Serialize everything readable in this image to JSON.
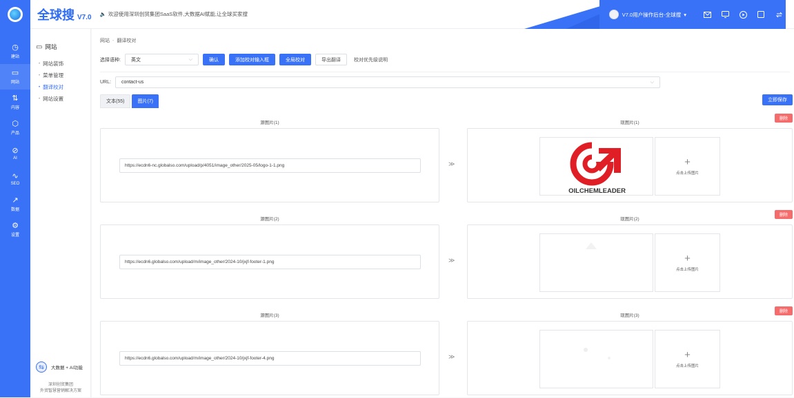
{
  "header": {
    "brand_name": "全球搜",
    "brand_version": "V7.0",
    "welcome": "欢迎使用深圳创贸集团SaaS软件,大数据AI赋能,让全球买家搜",
    "user_label": "V7.0用户操作后台-全球搜",
    "icons": [
      "mail-icon",
      "monitor-icon",
      "play-icon",
      "square-icon",
      "switch-icon"
    ]
  },
  "rail": {
    "items": [
      {
        "icon": "◷",
        "label": "建站"
      },
      {
        "icon": "▭",
        "label": "网站"
      },
      {
        "icon": "⇅",
        "label": "内容"
      },
      {
        "icon": "⬡",
        "label": "产品"
      },
      {
        "icon": "⊘",
        "label": "AI"
      },
      {
        "icon": "∿",
        "label": "SEO"
      },
      {
        "icon": "↗",
        "label": "数据"
      },
      {
        "icon": "⚙",
        "label": "设置"
      }
    ]
  },
  "sidebar": {
    "title": "网站",
    "items": [
      {
        "label": "网站装饰"
      },
      {
        "label": "菜单管理"
      },
      {
        "label": "翻译校对"
      },
      {
        "label": "网站设置"
      }
    ],
    "bigdata_label": "大数据 + AI功能",
    "org_line1": "深圳创贸集团",
    "org_line2": "外贸智慧营销解决方案"
  },
  "breadcrumb": {
    "first": "网站",
    "sep": "-",
    "second": "翻译校对"
  },
  "toolbar": {
    "lang_label": "选择语种:",
    "lang_value": "英文",
    "confirm": "确认",
    "add_input": "添加校对输入框",
    "global_check": "全局校对",
    "export": "导出翻译",
    "note": "校对优先级说明"
  },
  "url": {
    "label": "URL:",
    "value": "contact-us"
  },
  "tabs": {
    "text": "文本(55)",
    "image": "图片(7)"
  },
  "save_label": "立即保存",
  "delete_label": "删除",
  "arrow": "≫",
  "upload_label": "点击上传图片",
  "pairs": [
    {
      "src_title": "源图片(1)",
      "dst_title": "现图片(1)",
      "src_url": "https://ecdn6-nc.globalso.com/upload/p/4051/image_other/2025-05/logo-1-1.png",
      "logo_text": "OILCHEMLEADER"
    },
    {
      "src_title": "源图片(2)",
      "dst_title": "现图片(2)",
      "src_url": "https://ecdn6.globalso.com/upload/m/image_other/2024-10/jxjf-footer-1.png"
    },
    {
      "src_title": "源图片(3)",
      "dst_title": "现图片(3)",
      "src_url": "https://ecdn6.globalso.com/upload/m/image_other/2024-10/jxjf-footer-4.png"
    }
  ],
  "colors": {
    "primary": "#3a72f7",
    "danger": "#f56c6c",
    "logo_red": "#e01e26"
  }
}
